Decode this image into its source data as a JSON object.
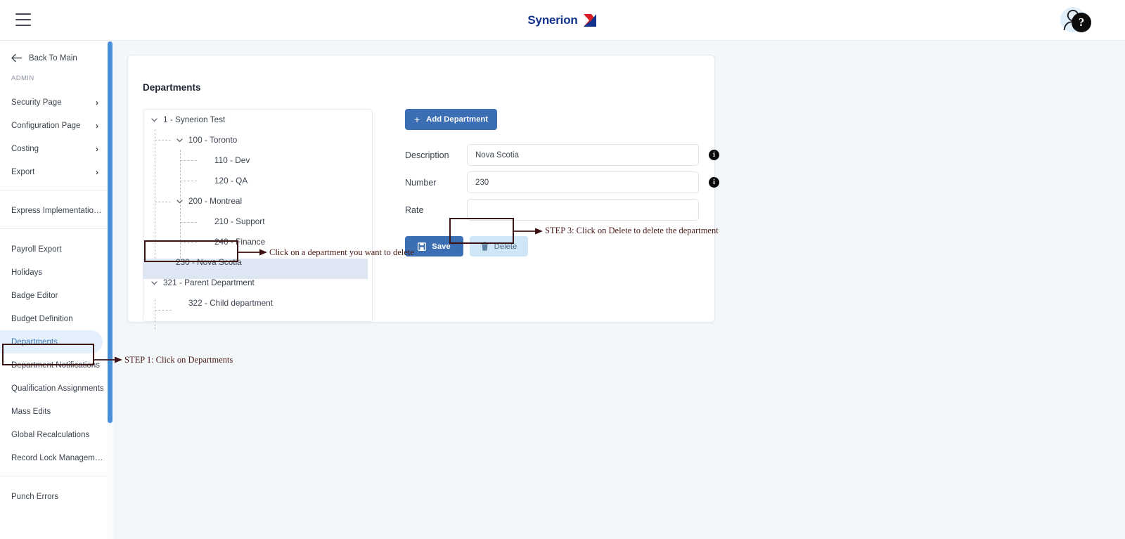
{
  "header": {
    "menu_icon": "hamburger-icon",
    "brand_text": "Synerion",
    "brand_mark_icon": "synerion-arrow-logo",
    "avatar_icon": "user-avatar-icon",
    "help_badge_label": "?",
    "brand_color": "#12348f",
    "accent_color": "#3c6eb4"
  },
  "sidebar": {
    "back_label": "Back To Main",
    "back_icon": "arrow-left-icon",
    "section_label": "ADMIN",
    "groups": [
      {
        "items": [
          {
            "label": "Security Page",
            "chevron": "chevron-right-icon",
            "expandable": true,
            "active": false
          },
          {
            "label": "Configuration Page",
            "chevron": "chevron-right-icon",
            "expandable": true,
            "active": false
          },
          {
            "label": "Costing",
            "chevron": "chevron-right-icon",
            "expandable": true,
            "active": false
          },
          {
            "label": "Export",
            "chevron": "chevron-right-icon",
            "expandable": true,
            "active": false
          }
        ]
      },
      {
        "items": [
          {
            "label": "Express Implementation P...",
            "expandable": false,
            "active": false
          }
        ]
      },
      {
        "items": [
          {
            "label": "Payroll Export",
            "expandable": false,
            "active": false
          },
          {
            "label": "Holidays",
            "expandable": false,
            "active": false
          },
          {
            "label": "Badge Editor",
            "expandable": false,
            "active": false
          },
          {
            "label": "Budget Definition",
            "expandable": false,
            "active": false
          },
          {
            "label": "Departments",
            "expandable": false,
            "active": true
          },
          {
            "label": "Department Notifications",
            "expandable": false,
            "active": false
          },
          {
            "label": "Qualification Assignments",
            "expandable": false,
            "active": false
          },
          {
            "label": "Mass Edits",
            "expandable": false,
            "active": false
          },
          {
            "label": "Global Recalculations",
            "expandable": false,
            "active": false
          },
          {
            "label": "Record Lock Management",
            "expandable": false,
            "active": false
          }
        ]
      },
      {
        "items": [
          {
            "label": "Punch Errors",
            "expandable": false,
            "active": false
          }
        ]
      }
    ],
    "active_bg_color": "#e4f0fb",
    "active_text_color": "#3e7bbd",
    "scrollbar_color": "#4a90d9"
  },
  "page": {
    "title": "Departments"
  },
  "tree": {
    "nodes": [
      {
        "label": "1 - Synerion Test",
        "depth": 0,
        "caret": "chevron-down-icon",
        "expanded": true,
        "selected": false
      },
      {
        "label": "100 - Toronto",
        "depth": 1,
        "caret": "chevron-down-icon",
        "expanded": true,
        "selected": false
      },
      {
        "label": "110 - Dev",
        "depth": 2,
        "caret": "",
        "expanded": false,
        "selected": false
      },
      {
        "label": "120 - QA",
        "depth": 2,
        "caret": "",
        "expanded": false,
        "selected": false
      },
      {
        "label": "200 - Montreal",
        "depth": 1,
        "caret": "chevron-down-icon",
        "expanded": true,
        "selected": false
      },
      {
        "label": "210 - Support",
        "depth": 2,
        "caret": "",
        "expanded": false,
        "selected": false
      },
      {
        "label": "240 - Finance",
        "depth": 2,
        "caret": "",
        "expanded": false,
        "selected": false
      },
      {
        "label": "230 - Nova Scotia",
        "depth": 1,
        "caret": "",
        "expanded": false,
        "selected": true
      },
      {
        "label": "321 - Parent Department",
        "depth": 0,
        "caret": "chevron-down-icon",
        "expanded": true,
        "selected": false
      },
      {
        "label": "322 - Child department",
        "depth": 1,
        "caret": "",
        "expanded": false,
        "selected": false
      }
    ],
    "selected_bg_color": "#dde6f2"
  },
  "form": {
    "add_button_label": "Add Department",
    "add_button_icon": "plus-icon",
    "fields": [
      {
        "label": "Description",
        "value": "Nova Scotia",
        "placeholder": "",
        "info_icon": "info-icon",
        "has_info": true
      },
      {
        "label": "Number",
        "value": "230",
        "placeholder": "",
        "info_icon": "info-icon",
        "has_info": true
      },
      {
        "label": "Rate",
        "value": "",
        "placeholder": "",
        "info_icon": "",
        "has_info": false
      }
    ],
    "save_label": "Save",
    "save_icon": "save-floppy-icon",
    "delete_label": "Delete",
    "delete_icon": "trash-icon"
  },
  "annotations": [
    {
      "name": "step1",
      "text": "STEP 1: Click on Departments"
    },
    {
      "name": "step2",
      "text": "Click on a department you want to delete"
    },
    {
      "name": "step3",
      "text": "STEP 3: Click on Delete to delete the department"
    }
  ],
  "annotation_color": "#3d1212"
}
